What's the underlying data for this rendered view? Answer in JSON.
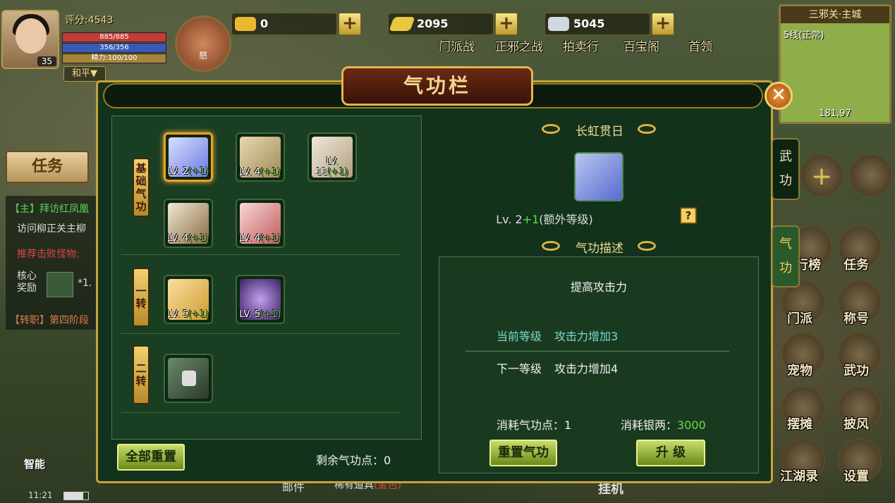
{
  "player": {
    "score_label": "评分:4543",
    "level": "35",
    "hp": "885/885",
    "mp": "356/356",
    "energy": "精力:100/100",
    "mode": "和平▼",
    "rage": "怒"
  },
  "currency": {
    "gold": "0",
    "gold_bar": "2095",
    "silver": "5045"
  },
  "top_menu": [
    "门派战",
    "正邪之战",
    "拍卖行",
    "百宝阁",
    "首领"
  ],
  "minimap": {
    "title": "三邪关·主城",
    "line": "5线(正常)",
    "coords": "181,97"
  },
  "left_hud": {
    "task_button": "任务",
    "quest_main": "【主】拜访红凤凰",
    "quest_sub": "访问柳正关主柳",
    "quest_monster": "推荐击败怪物:",
    "core_reward": "核心奖励",
    "reward_count": "*1.",
    "quest_job": "【转职】第四阶段",
    "smart": "智能",
    "time": "11:21"
  },
  "bottom_hud": {
    "mail": "邮件",
    "rare_items": "稀有道具",
    "rare_tag": "(金色)",
    "hang": "挂机"
  },
  "right_icons": [
    {
      "label": "排行榜",
      "icon": "ranking-icon"
    },
    {
      "label": "任务",
      "icon": "quest-icon"
    },
    {
      "label": "门派",
      "icon": "faction-icon"
    },
    {
      "label": "称号",
      "icon": "title-icon"
    },
    {
      "label": "宠物",
      "icon": "pet-icon"
    },
    {
      "label": "武功",
      "icon": "martial-icon"
    },
    {
      "label": "摆摊",
      "icon": "stall-icon"
    },
    {
      "label": "披风",
      "icon": "cape-icon"
    },
    {
      "label": "江湖录",
      "icon": "jianghu-icon"
    },
    {
      "label": "设置",
      "icon": "settings-icon"
    }
  ],
  "panel": {
    "title": "气功栏",
    "close": "✕",
    "tabs": [
      {
        "label": "武功",
        "active": false
      },
      {
        "label": "气功",
        "active": true
      }
    ],
    "sections": [
      {
        "tag": "基础气功",
        "skills": [
          {
            "lv": "LV. 2",
            "bonus": "(+1)",
            "selected": true
          },
          {
            "lv": "LV. 4",
            "bonus": "(+1)"
          },
          {
            "lv": "LV. 11",
            "bonus": "(+1)"
          },
          {
            "lv": "LV. 4",
            "bonus": "(+1)"
          },
          {
            "lv": "LV. 4",
            "bonus": "(+1)"
          }
        ]
      },
      {
        "tag": "一转",
        "skills": [
          {
            "lv": "LV. 5",
            "bonus": "(+1)"
          },
          {
            "lv": "LV. 5",
            "bonus": "(+1)"
          }
        ]
      },
      {
        "tag": "二转",
        "skills": [
          {
            "locked": true
          }
        ]
      }
    ],
    "reset_all": "全部重置",
    "remaining_points": "剩余气功点：0",
    "detail": {
      "name": "长虹贯日",
      "level": "Lv. 2",
      "bonus": "+1",
      "extra": "(额外等级)",
      "help": "?",
      "desc_header": "气功描述",
      "desc": "提高攻击力",
      "current_label": "当前等级",
      "current_value": "攻击力增加3",
      "next_label": "下一等级",
      "next_value": "攻击力增加4",
      "cost_points_label": "消耗气功点：",
      "cost_points": "1",
      "cost_silver_label": "消耗银两：",
      "cost_silver": "3000",
      "reset_button": "重置气功",
      "upgrade_button": "升  级"
    }
  },
  "colors": {
    "panel_bg": "#12321c",
    "gold_border": "#c8a23a",
    "bonus_green": "#6ad84a",
    "current_cyan": "#7ad8d0"
  }
}
